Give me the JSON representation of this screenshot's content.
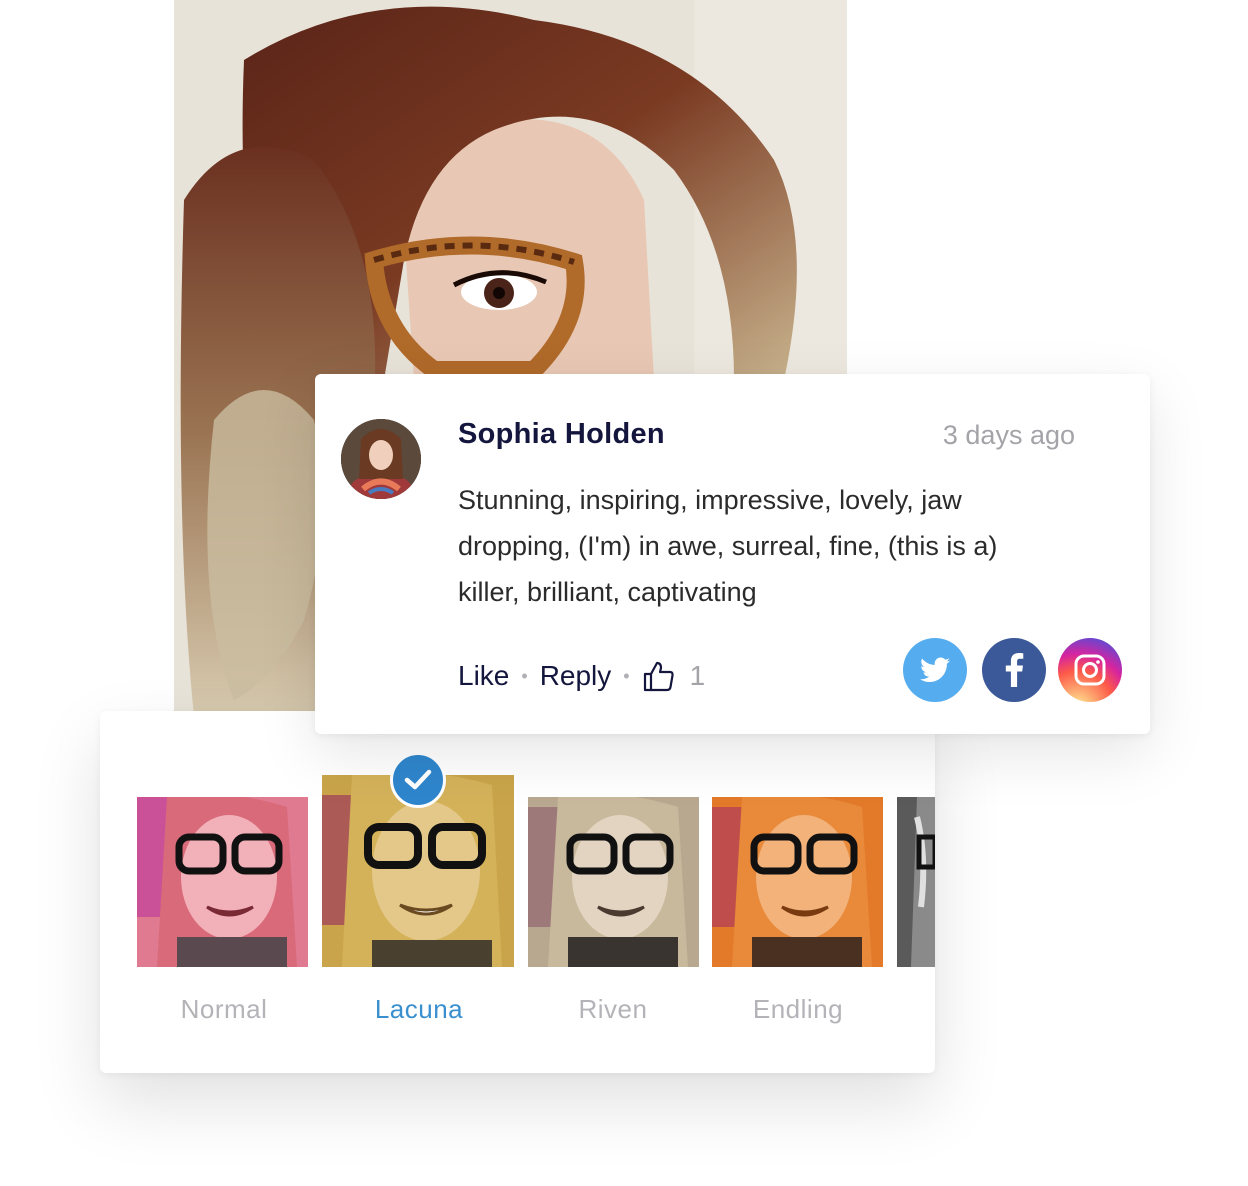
{
  "comment": {
    "author": "Sophia Holden",
    "time": "3 days ago",
    "text": "Stunning, inspiring, impressive, lovely, jaw dropping, (I'm) in awe, surreal, fine, (this is a) killer, brilliant, captivating",
    "actions": {
      "like_label": "Like",
      "reply_label": "Reply",
      "like_count": "1"
    },
    "social": [
      "twitter-icon",
      "facebook-icon",
      "instagram-icon"
    ]
  },
  "filters": {
    "selected": "Lacuna",
    "items": [
      {
        "label": "Normal",
        "tint": "#e58aa0"
      },
      {
        "label": "Lacuna",
        "tint": "#c9a44a"
      },
      {
        "label": "Riven",
        "tint": "#c9b89e"
      },
      {
        "label": "Endling",
        "tint": "#e88a3a"
      }
    ]
  },
  "colors": {
    "accent": "#3a8fcf",
    "author": "#14163d",
    "muted": "#a4a4a8"
  }
}
